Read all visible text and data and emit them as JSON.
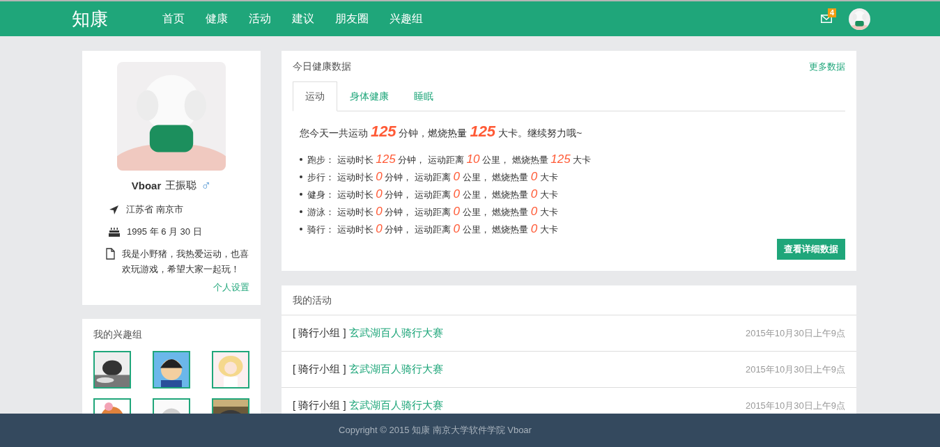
{
  "navbar": {
    "brand": "知康",
    "items": [
      {
        "label": "首页"
      },
      {
        "label": "健康"
      },
      {
        "label": "活动"
      },
      {
        "label": "建议"
      },
      {
        "label": "朋友圈"
      },
      {
        "label": "兴趣组"
      }
    ],
    "mail_count": "4"
  },
  "profile": {
    "nickname": "Vboar",
    "name": "王振聪",
    "gender": "♂",
    "location": "江苏省 南京市",
    "birthday": "1995 年 6 月 30 日",
    "bio": "我是小野猪，我热爱运动，也喜欢玩游戏，希望大家一起玩！",
    "settings_link": "个人设置"
  },
  "groups": {
    "title": "我的兴趣组"
  },
  "health": {
    "title": "今日健康数据",
    "more_link": "更多数据",
    "tabs": [
      {
        "label": "运动",
        "selected": true
      },
      {
        "label": "身体健康",
        "selected": false
      },
      {
        "label": "睡眠",
        "selected": false
      }
    ],
    "summary": [
      {
        "text": "您今天一共运动 "
      },
      {
        "text": "125",
        "kind": "number"
      },
      {
        "text": " 分钟，燃烧热量 "
      },
      {
        "text": "125",
        "kind": "number"
      },
      {
        "text": " 大卡。继续努力哦~"
      }
    ],
    "rows": [
      {
        "sport": "跑步：",
        "duration_label": "运动时长",
        "duration": "125",
        "duration_unit": "分钟，",
        "distance_label": "运动距离",
        "distance": "10",
        "distance_unit": "公里，",
        "calories_label": "燃烧热量",
        "calories": "125",
        "calories_unit": "大卡"
      },
      {
        "sport": "步行：",
        "duration_label": "运动时长",
        "duration": "0",
        "duration_unit": "分钟，",
        "distance_label": "运动距离",
        "distance": "0",
        "distance_unit": "公里，",
        "calories_label": "燃烧热量",
        "calories": "0",
        "calories_unit": "大卡"
      },
      {
        "sport": "健身：",
        "duration_label": "运动时长",
        "duration": "0",
        "duration_unit": "分钟，",
        "distance_label": "运动距离",
        "distance": "0",
        "distance_unit": "公里，",
        "calories_label": "燃烧热量",
        "calories": "0",
        "calories_unit": "大卡"
      },
      {
        "sport": "游泳：",
        "duration_label": "运动时长",
        "duration": "0",
        "duration_unit": "分钟，",
        "distance_label": "运动距离",
        "distance": "0",
        "distance_unit": "公里，",
        "calories_label": "燃烧热量",
        "calories": "0",
        "calories_unit": "大卡"
      },
      {
        "sport": "骑行：",
        "duration_label": "运动时长",
        "duration": "0",
        "duration_unit": "分钟，",
        "distance_label": "运动距离",
        "distance": "0",
        "distance_unit": "公里，",
        "calories_label": "燃烧热量",
        "calories": "0",
        "calories_unit": "大卡"
      }
    ],
    "detail_button": "查看详细数据"
  },
  "activities": {
    "title": "我的活动",
    "items": [
      {
        "group": "[ 骑行小组 ]",
        "title": "玄武湖百人骑行大赛",
        "time": "2015年10月30日上午9点"
      },
      {
        "group": "[ 骑行小组 ]",
        "title": "玄武湖百人骑行大赛",
        "time": "2015年10月30日上午9点"
      },
      {
        "group": "[ 骑行小组 ]",
        "title": "玄武湖百人骑行大赛",
        "time": "2015年10月30日上午9点"
      }
    ]
  },
  "footer": "Copyright © 2015 知康 南京大学软件学院 Vboar"
}
